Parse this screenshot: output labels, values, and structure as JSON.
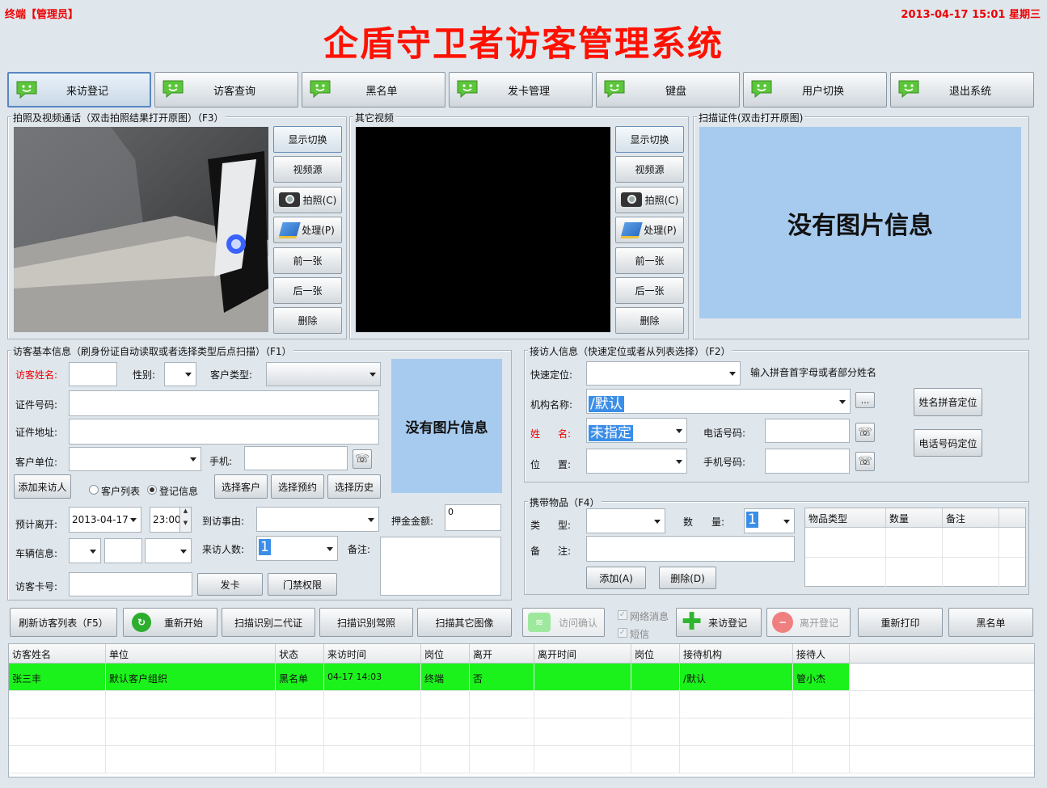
{
  "header": {
    "terminal": "终端【管理员】",
    "datetime": "2013-04-17 15:01 星期三",
    "title": "企盾守卫者访客管理系统"
  },
  "nav": [
    "来访登记",
    "访客查询",
    "黑名单",
    "发卡管理",
    "键盘",
    "用户切换",
    "退出系统"
  ],
  "photo": {
    "legend": "拍照及视频通话（双击拍照结果打开原图）（F3）",
    "buttons": [
      "显示切换",
      "视频源",
      "拍照(C)",
      "处理(P)",
      "前一张",
      "后一张",
      "删除"
    ]
  },
  "other_video": {
    "legend": "其它视频",
    "buttons": [
      "显示切换",
      "视频源",
      "拍照(C)",
      "处理(P)",
      "前一张",
      "后一张",
      "删除"
    ]
  },
  "scan": {
    "legend": "扫描证件(双击打开原图)",
    "noimg": "没有图片信息"
  },
  "visitor": {
    "legend": "访客基本信息（刷身份证自动读取或者选择类型后点扫描）（F1）",
    "name_label": "访客姓名:",
    "gender_label": "性别:",
    "ctype_label": "客户类型:",
    "id_label": "证件号码:",
    "addr_label": "证件地址:",
    "unit_label": "客户单位:",
    "mobile_label": "手机:",
    "add_btn": "添加来访人",
    "radio_list": "客户列表",
    "radio_reg": "登记信息",
    "select_customer": "选择客户",
    "select_appt": "选择预约",
    "select_history": "选择历史",
    "noimg": "没有图片信息",
    "leave_label": "预计离开:",
    "leave_date": "2013-04-17",
    "leave_time": "23:00:",
    "reason_label": "到访事由:",
    "deposit_label": "押金金额:",
    "deposit_value": "0",
    "vehicle_label": "车辆信息:",
    "count_label": "来访人数:",
    "count_value": "1",
    "note_label": "备注:",
    "card_label": "访客卡号:",
    "issue_btn": "发卡",
    "access_btn": "门禁权限"
  },
  "host": {
    "legend": "接访人信息（快速定位或者从列表选择）（F2）",
    "quick_label": "快速定位:",
    "quick_hint": "输入拼音首字母或者部分姓名",
    "org_label": "机构名称:",
    "org_value": "/默认",
    "ellipsis": "...",
    "name_label1": "姓",
    "name_label2": "名:",
    "name_value": "未指定",
    "phone_label": "电话号码:",
    "pos_label1": "位",
    "pos_label2": "置:",
    "mobile_label": "手机号码:",
    "pinyin_btn": "姓名拼音定位",
    "phone_btn": "电话号码定位"
  },
  "items": {
    "legend": "携带物品（F4）",
    "type_label1": "类",
    "type_label2": "型:",
    "qty_label1": "数",
    "qty_label2": "量:",
    "qty_value": "1",
    "note_label1": "备",
    "note_label2": "注:",
    "add_btn": "添加(A)",
    "del_btn": "删除(D)",
    "columns": [
      "物品类型",
      "数量",
      "备注"
    ]
  },
  "actions": {
    "refresh": "刷新访客列表（F5）",
    "restart": "重新开始",
    "scan_id2": "扫描识别二代证",
    "scan_license": "扫描识别驾照",
    "scan_other": "扫描其它图像",
    "confirm": "访问确认",
    "net_msg": "网络消息",
    "sms": "短信",
    "register": "来访登记",
    "leave": "离开登记",
    "reprint": "重新打印",
    "blacklist": "黑名单"
  },
  "table": {
    "columns": [
      "访客姓名",
      "单位",
      "状态",
      "来访时间",
      "岗位",
      "离开",
      "离开时间",
      "岗位",
      "接待机构",
      "接待人"
    ],
    "rows": [
      [
        "张三丰",
        "默认客户组织",
        "黑名单",
        "04-17 14:03",
        "终端",
        "否",
        "",
        "",
        "/默认",
        "管小杰"
      ]
    ]
  },
  "colors": {
    "title_red": "#ff1100",
    "row_green": "#1bf21b",
    "noimg_bg": "#a7cbef",
    "select_blue": "#3b8ee8"
  }
}
